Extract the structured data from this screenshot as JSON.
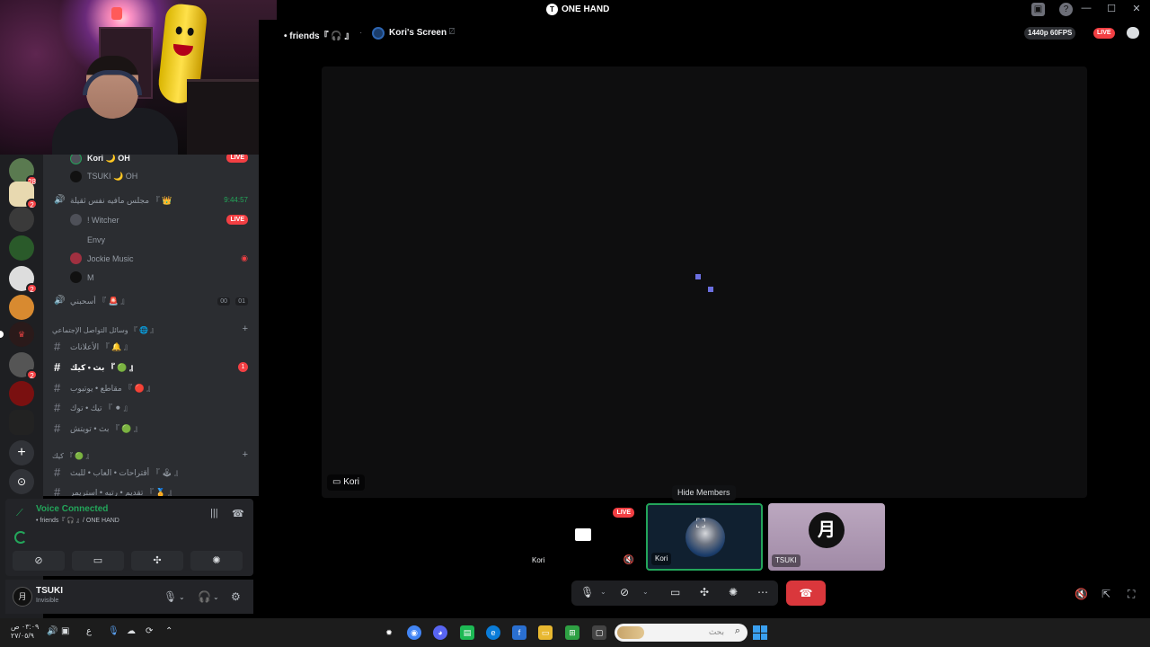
{
  "window": {
    "title": "ONE HAND"
  },
  "topbar": {
    "channel": "• friends『 🎧 』",
    "screen_name": "Kori's Screen",
    "quality": "1440p 60FPS",
    "live": "LIVE"
  },
  "channels": {
    "voice_users_top": [
      {
        "name": "Kori 🌙 OH",
        "live": "LIVE"
      },
      {
        "name": "TSUKI 🌙 OH"
      }
    ],
    "voice_channel_2": {
      "name": "مجلس مافيه نفس ثقيلة 『 👑",
      "time": "9:44:57"
    },
    "voice_users_2": [
      {
        "name": "! Witcher",
        "live": "LIVE"
      },
      {
        "name": "Envy"
      },
      {
        "name": "Jockie Music"
      },
      {
        "name": "M"
      }
    ],
    "voice_channel_3": {
      "name": "أسحبني 『 🚨 』",
      "count_a": "00",
      "count_b": "01"
    },
    "category_1": "وسائل التواصل الإجتماعي 『 🌐 』",
    "text_channels": [
      {
        "name": "الأعلانات 『 🔔 』"
      },
      {
        "name": "بث • كيك 『 🟢 』",
        "mention": "1"
      },
      {
        "name": "مقاطع • يوتيوب 『 🔴 』"
      },
      {
        "name": "تيك • توك 『 ⚫ 』"
      },
      {
        "name": "بث • تويتش 『 🟢 』"
      }
    ],
    "category_2": "كيك 『 🟢 』",
    "text_channels_2": [
      {
        "name": "أقتراحات • العاب • للبث 『 🕹 』"
      },
      {
        "name": "تقديم • رتبه • استريمر 『 🏅 』"
      }
    ]
  },
  "servers": {
    "badges": [
      "28",
      "2",
      "2",
      "2"
    ]
  },
  "voice_panel": {
    "title": "Voice Connected",
    "subtitle": "• friends『 🎧 』/ ONE HAND"
  },
  "user": {
    "name": "TSUKI",
    "status": "Invisible"
  },
  "stream": {
    "name_tag": "Kori"
  },
  "tooltip": "Hide Members",
  "tiles": [
    {
      "name": "Kori",
      "live": "LIVE"
    },
    {
      "name": "Kori"
    },
    {
      "name": "TSUKI"
    }
  ],
  "taskbar": {
    "time": "٠٣:٠٩ ص",
    "date": "٢٧/٠٥/٩",
    "lang": "ع",
    "search_placeholder": "بحث"
  },
  "icons": {
    "accent": "#23a55a",
    "danger": "#f23f43"
  }
}
